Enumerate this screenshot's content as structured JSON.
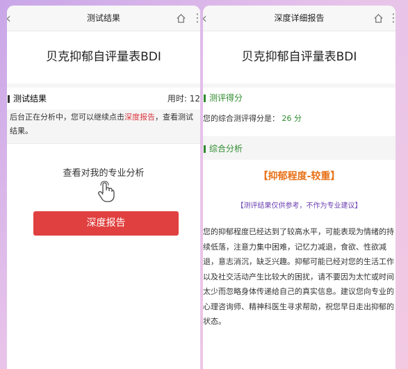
{
  "left": {
    "nav_title": "测试结果",
    "page_title": "贝克抑郁自评量表BDI",
    "section_label": "测试结果",
    "time_label": "用时: 12",
    "notice_prefix": "后台正在分析中，您可以继续点击",
    "notice_link": "深度报告",
    "notice_suffix": "，查看测试结果。",
    "analysis_prompt": "查看对我的专业分析",
    "report_button": "深度报告"
  },
  "right": {
    "nav_title": "深度详细报告",
    "page_title": "贝克抑郁自评量表BDI",
    "score_section": "测评得分",
    "score_prefix": "您的综合测评得分是：",
    "score_value": "26 分",
    "analysis_section": "综合分析",
    "level_heading": "【抑郁程度-较重】",
    "disclaimer": "【测评结果仅供参考，不作为专业建议】",
    "analysis_text": "您的抑郁程度已经达到了较高水平，可能表现为情绪的持续低落，注意力集中困难，记忆力减退，食欲、性欲减退，意志消沉，缺乏兴趣。抑郁可能已经对您的生活工作以及社交活动产生比较大的困扰，请不要因为太忙或时间太少而忽略身体传递给自己的真实信息。建议您向专业的心理咨询师、精神科医生寻求帮助，祝您早日走出抑郁的状态。"
  },
  "colors": {
    "accent_red": "#e0403f",
    "green": "#2e8b2e",
    "orange": "#e8731a",
    "purple": "#6b3fb0",
    "link_red": "#d9363e"
  }
}
